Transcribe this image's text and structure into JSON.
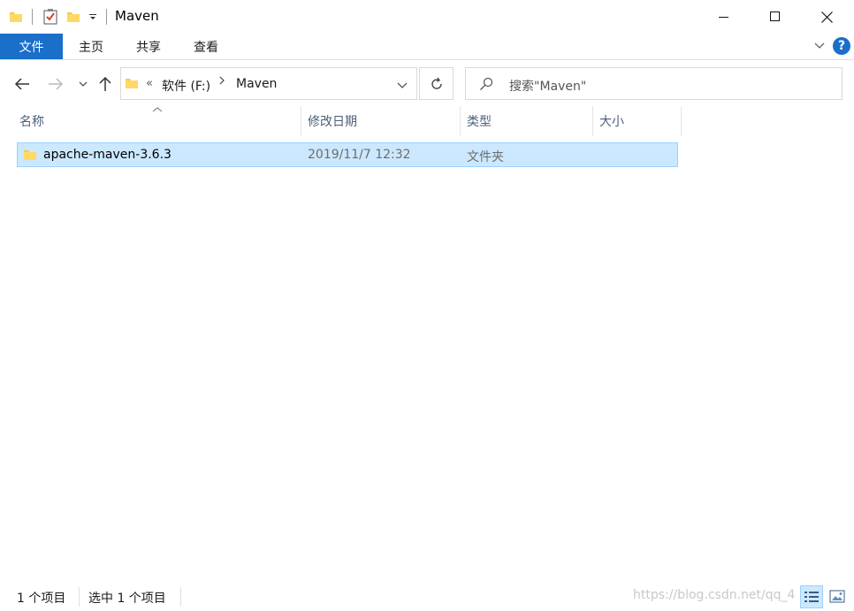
{
  "window": {
    "title": "Maven"
  },
  "ribbon": {
    "tabs": [
      {
        "label": "文件",
        "active": true
      },
      {
        "label": "主页",
        "active": false
      },
      {
        "label": "共享",
        "active": false
      },
      {
        "label": "查看",
        "active": false
      }
    ],
    "help_label": "?"
  },
  "navigation": {
    "breadcrumb_overflow": "«",
    "breadcrumbs": [
      "软件 (F:)",
      "Maven"
    ],
    "search_placeholder": "搜索\"Maven\""
  },
  "columns": {
    "name": "名称",
    "modified": "修改日期",
    "type": "类型",
    "size": "大小"
  },
  "files": [
    {
      "name": "apache-maven-3.6.3",
      "modified": "2019/11/7 12:32",
      "type": "文件夹",
      "size": ""
    }
  ],
  "status": {
    "item_count": "1 个项目",
    "selected_count": "选中 1 个项目"
  },
  "watermark": "https://blog.csdn.net/qq_4",
  "colors": {
    "accent": "#1a6fc9",
    "selection": "#cce8ff",
    "selection_border": "#99d1ff",
    "folder": "#f7c94b"
  },
  "icons": [
    "folder-icon",
    "properties-icon",
    "new-folder-icon",
    "minimize-icon",
    "maximize-icon",
    "close-icon",
    "back-icon",
    "forward-icon",
    "up-icon",
    "refresh-icon",
    "search-icon",
    "details-view-icon",
    "large-icons-view-icon"
  ]
}
